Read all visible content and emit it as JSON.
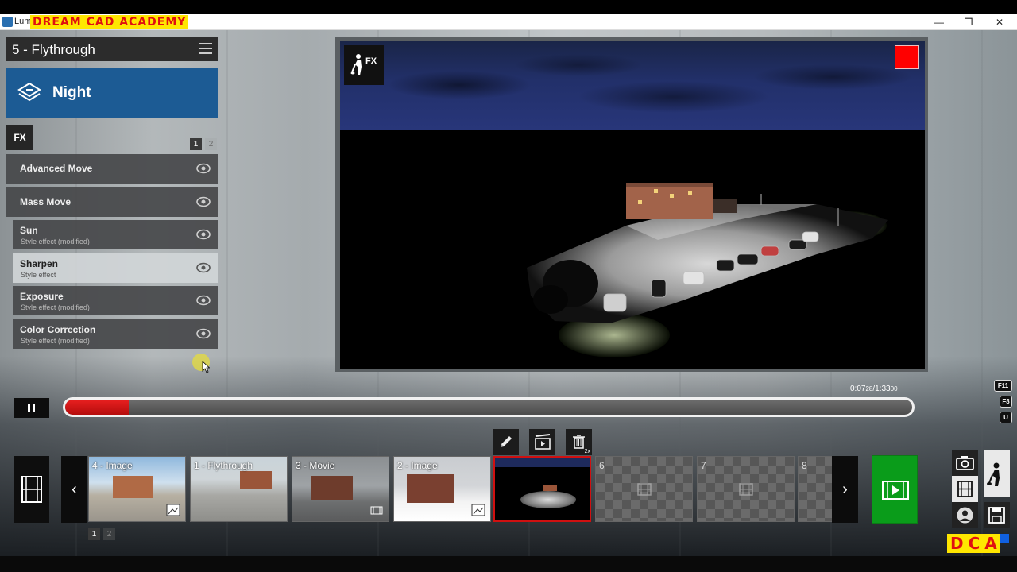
{
  "window": {
    "title_partial": "Lumi",
    "watermark": "DREAM CAD ACADEMY",
    "minimize": "—",
    "restore": "❐",
    "close": "✕"
  },
  "panel": {
    "title": "5 - Flythrough",
    "style_name": "Night",
    "fx_tab": "FX",
    "pages": [
      "1",
      "2"
    ],
    "effects": [
      {
        "name": "Advanced Move",
        "sub": ""
      },
      {
        "name": "Mass Move",
        "sub": ""
      },
      {
        "name": "Sun",
        "sub": "Style effect (modified)"
      },
      {
        "name": "Sharpen",
        "sub": "Style effect"
      },
      {
        "name": "Exposure",
        "sub": "Style effect (modified)"
      },
      {
        "name": "Color Correction",
        "sub": "Style effect (modified)"
      }
    ]
  },
  "viewport": {
    "fx_badge": "FX",
    "record_color": "#ff0000"
  },
  "playback": {
    "time_current": "0:07",
    "time_current_frames": "28",
    "time_separator": "/",
    "time_total": "1:33",
    "time_total_frames": "00",
    "progress": 0.075
  },
  "shortcuts": [
    "F11",
    "F8",
    "U"
  ],
  "clip_tools": {
    "duplicate_badge": "2x"
  },
  "filmstrip": {
    "slots": [
      {
        "label": "4 - Image",
        "kind": "image"
      },
      {
        "label": "1 - Flythrough",
        "kind": "movie"
      },
      {
        "label": "3 - Movie",
        "kind": "movie"
      },
      {
        "label": "2 - Image",
        "kind": "image"
      },
      {
        "label": "",
        "kind": "current"
      },
      {
        "label": "6",
        "kind": "empty"
      },
      {
        "label": "7",
        "kind": "empty"
      },
      {
        "label": "8",
        "kind": "empty"
      }
    ],
    "pages": [
      "1",
      "2"
    ],
    "prev": "‹",
    "next": "›"
  },
  "branding": {
    "dca": "DCA"
  },
  "colors": {
    "accent_blue": "#1c5b94",
    "record_red": "#ff0000",
    "render_green": "#0a9c1a",
    "timeline_red": "#d81818"
  }
}
